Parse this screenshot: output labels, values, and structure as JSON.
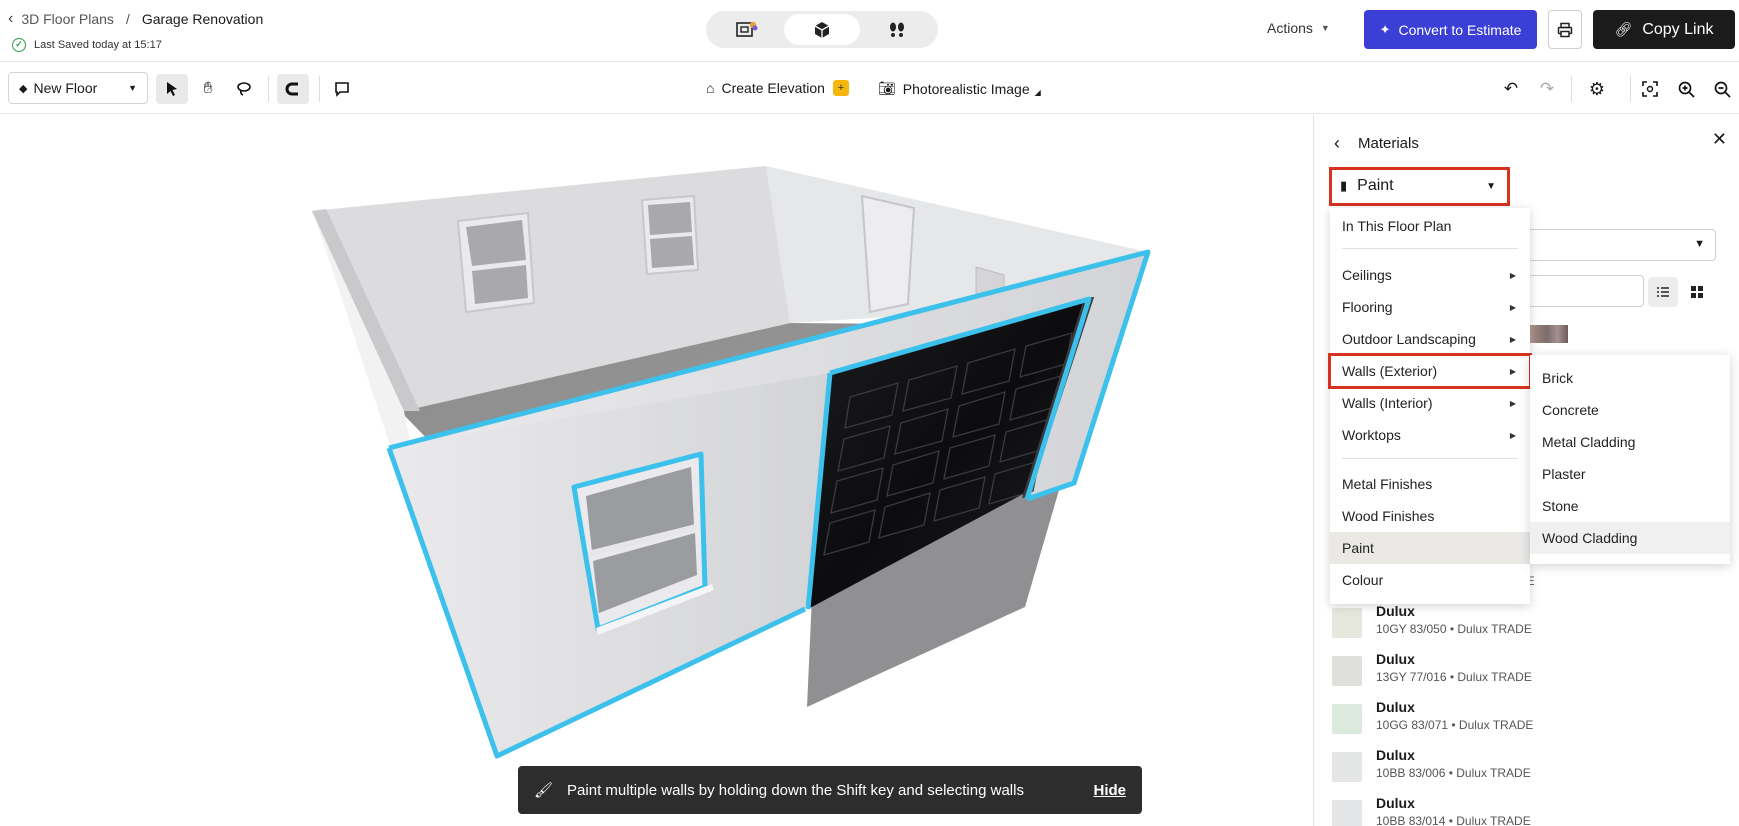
{
  "breadcrumb": {
    "parent": "3D Floor Plans",
    "current": "Garage Renovation"
  },
  "save_status": "Last Saved today at 15:17",
  "header": {
    "actions_label": "Actions",
    "convert_label": "Convert to Estimate",
    "copy_link_label": "Copy Link"
  },
  "toolbar": {
    "floor_label": "New Floor",
    "create_elevation_label": "Create Elevation",
    "photorealistic_label": "Photorealistic Image"
  },
  "toast": {
    "message": "Paint multiple walls by holding down the Shift key and selecting walls",
    "hide_label": "Hide"
  },
  "panel": {
    "title": "Materials",
    "category_selected": "Paint",
    "colours": [
      {
        "brand": "Dulux",
        "code": "10GY 83/050 • Dulux TRADE",
        "color": "#e6e7dd"
      },
      {
        "brand": "Dulux",
        "code": "13GY 77/016 • Dulux TRADE",
        "color": "#dfe0db"
      },
      {
        "brand": "Dulux",
        "code": "10GG 83/071 • Dulux TRADE",
        "color": "#dbeadc"
      },
      {
        "brand": "Dulux",
        "code": "10BB 83/006 • Dulux TRADE",
        "color": "#e4e5e5"
      },
      {
        "brand": "Dulux",
        "code": "10BB 83/014 • Dulux TRADE",
        "color": "#e3e5e6"
      }
    ],
    "partial_text": "DE"
  },
  "category_menu": {
    "items": [
      {
        "label": "In This Floor Plan",
        "submenu": false
      },
      {
        "label": "Ceilings",
        "submenu": true
      },
      {
        "label": "Flooring",
        "submenu": true
      },
      {
        "label": "Outdoor Landscaping",
        "submenu": true
      },
      {
        "label": "Walls (Exterior)",
        "submenu": true
      },
      {
        "label": "Walls (Interior)",
        "submenu": true
      },
      {
        "label": "Worktops",
        "submenu": true
      },
      {
        "label": "Metal Finishes",
        "submenu": false
      },
      {
        "label": "Wood Finishes",
        "submenu": false
      },
      {
        "label": "Paint",
        "submenu": false
      },
      {
        "label": "Colour",
        "submenu": false
      }
    ]
  },
  "exterior_submenu": {
    "items": [
      "Brick",
      "Concrete",
      "Metal Cladding",
      "Plaster",
      "Stone",
      "Wood Cladding"
    ]
  },
  "colors": {
    "accent_purple": "#3c3fd6",
    "selection_blue": "#3cc0ec",
    "highlight_red": "#d6321f"
  }
}
